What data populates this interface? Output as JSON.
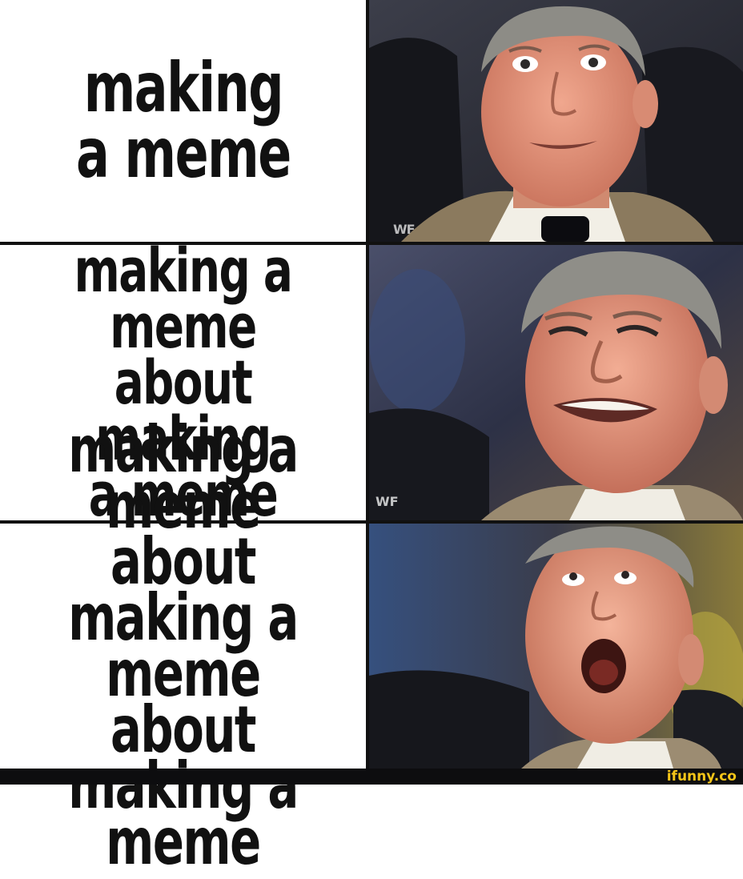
{
  "panels": [
    {
      "caption": "making\na meme",
      "reaction": "mildly interested"
    },
    {
      "caption": "making a meme\nabout making\na meme",
      "reaction": "excited"
    },
    {
      "caption": "making a meme\nabout making a\nmeme about\nmaking a meme",
      "reaction": "ecstatic"
    }
  ],
  "logo_text": "WF",
  "watermark": "ifunny.co",
  "colors": {
    "divider": "#111111",
    "text": "#111111",
    "footer": "#0d0d0f",
    "watermark": "#f5c518"
  }
}
